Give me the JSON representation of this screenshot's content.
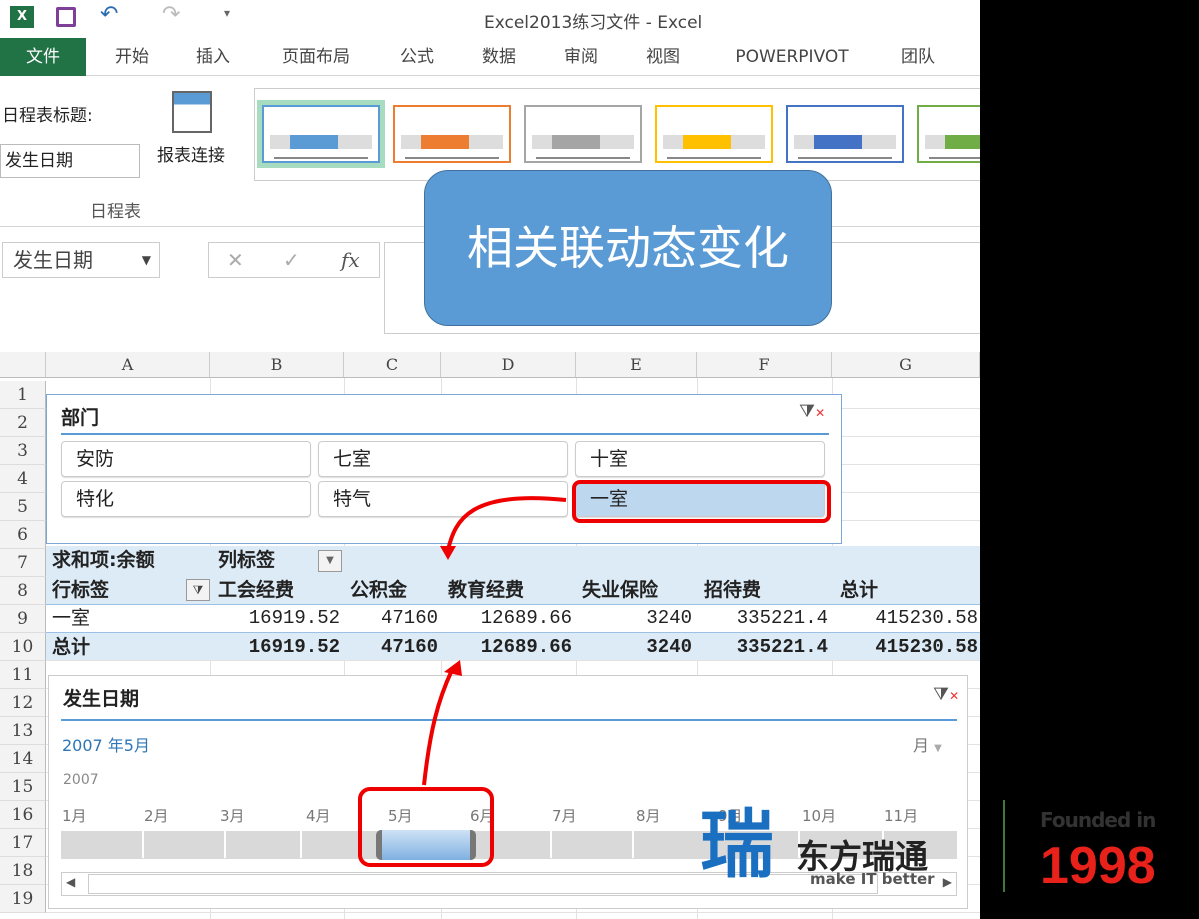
{
  "window": {
    "title": "Excel2013练习文件 - Excel"
  },
  "ribbon_tabs": [
    "文件",
    "开始",
    "插入",
    "页面布局",
    "公式",
    "数据",
    "审阅",
    "视图",
    "POWERPIVOT",
    "团队"
  ],
  "ribbon": {
    "timeline_caption_label": "日程表标题:",
    "timeline_caption_value": "发生日期",
    "report_connections": "报表连接",
    "group_label": "日程表",
    "style_colors": [
      "#5b9bd5",
      "#ed7d31",
      "#a5a5a5",
      "#ffc000",
      "#4472c4",
      "#70ad47"
    ]
  },
  "formula_bar": {
    "name_box": "发生日期",
    "fx": "fx",
    "cancel": "✕",
    "enter": "✓"
  },
  "callout": {
    "text": "相关联动态变化",
    "color": "#5b9bd5"
  },
  "columns": [
    "A",
    "B",
    "C",
    "D",
    "E",
    "F",
    "G"
  ],
  "rows": [
    "1",
    "2",
    "3",
    "4",
    "5",
    "6",
    "7",
    "8",
    "9",
    "10",
    "11",
    "12",
    "13",
    "14",
    "15",
    "16",
    "17",
    "18",
    "19"
  ],
  "slicer": {
    "title": "部门",
    "items": [
      "安防",
      "七室",
      "十室",
      "特化",
      "特气",
      "一室"
    ],
    "selected": "一室"
  },
  "pivot": {
    "value_label": "求和项:余额",
    "col_label": "列标签",
    "row_label": "行标签",
    "headers": [
      "工会经费",
      "公积金",
      "教育经费",
      "失业保险",
      "招待费",
      "总计"
    ],
    "rows": [
      {
        "label": "一室",
        "values": [
          "16919.52",
          "47160",
          "12689.66",
          "3240",
          "335221.4",
          "415230.58"
        ]
      },
      {
        "label": "总计",
        "values": [
          "16919.52",
          "47160",
          "12689.66",
          "3240",
          "335221.4",
          "415230.58"
        ]
      }
    ]
  },
  "timeline": {
    "title": "发生日期",
    "selection": "2007 年5月",
    "level": "月",
    "year": "2007",
    "months": [
      "1月",
      "2月",
      "3月",
      "4月",
      "5月",
      "6月",
      "7月",
      "8月",
      "9月",
      "10月",
      "11月"
    ],
    "selected_months": [
      "5月"
    ]
  },
  "logo": {
    "cn": "东方瑞通",
    "en": "make IT better",
    "founded": "Founded in",
    "year": "1998"
  }
}
